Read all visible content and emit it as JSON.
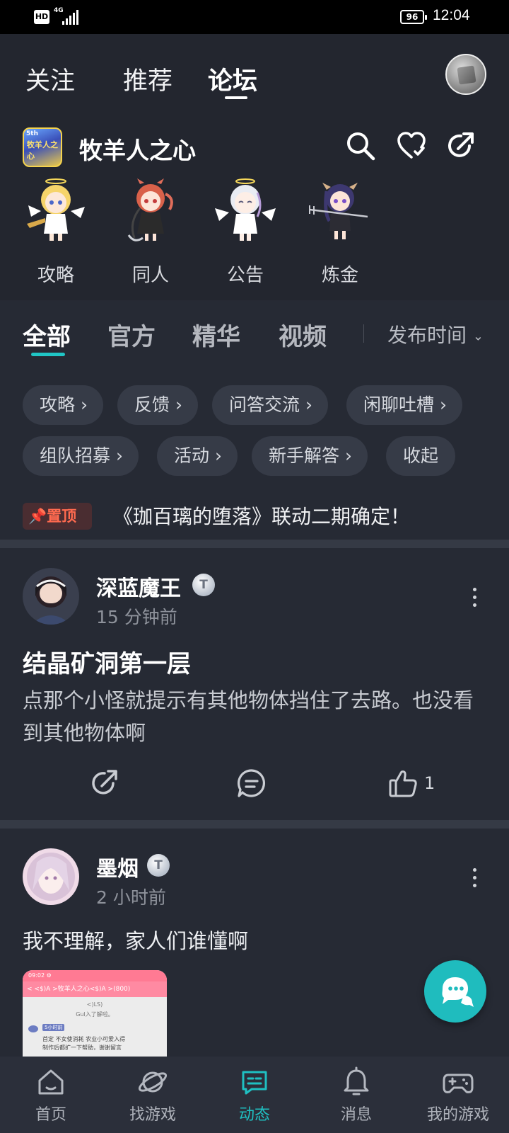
{
  "status_bar": {
    "hd": "HD",
    "network": "4G",
    "battery": "96",
    "time": "12:04"
  },
  "top_tabs": {
    "follow": "关注",
    "recommend": "推荐",
    "forum": "论坛"
  },
  "game": {
    "name": "牧羊人之心",
    "icon_text": "牧羊人之心",
    "icon_badge": "5th"
  },
  "categories": [
    {
      "label": "攻略"
    },
    {
      "label": "同人"
    },
    {
      "label": "公告"
    },
    {
      "label": "炼金"
    }
  ],
  "section_tabs": {
    "all": "全部",
    "official": "官方",
    "featured": "精华",
    "video": "视频",
    "sort": "发布时间"
  },
  "chips": [
    "攻略",
    "反馈",
    "问答交流",
    "闲聊吐槽",
    "组队招募",
    "活动",
    "新手解答",
    "收起"
  ],
  "pinned": {
    "badge": "置顶",
    "title": "《珈百璃的堕落》联动二期确定！"
  },
  "posts": [
    {
      "author": "深蓝魔王",
      "badge": "T",
      "time": "15 分钟前",
      "title": "结晶矿洞第一层",
      "body": "点那个小怪就提示有其他物体挡住了去路。也没看到其他物体啊",
      "likes": "1"
    },
    {
      "author": "墨烟",
      "badge": "T",
      "time": "2 小时前",
      "body": "我不理解，家人们谁懂啊"
    }
  ],
  "thumb": {
    "status": "09:02 ⚙",
    "header": "< <$)A  >牧羊人之心<$)A  >(800)",
    "line1": "<)LS)",
    "line2": "Gul入了解啦。",
    "badge": "5小时前",
    "line3": "首定 不女使消耗 农业小可爱入得",
    "line4": "制作后都扩一下帮助，谢谢留言"
  },
  "bottom_nav": [
    {
      "label": "首页",
      "icon": "home-icon"
    },
    {
      "label": "找游戏",
      "icon": "planet-icon"
    },
    {
      "label": "动态",
      "icon": "feed-icon"
    },
    {
      "label": "消息",
      "icon": "bell-icon"
    },
    {
      "label": "我的游戏",
      "icon": "gamepad-icon"
    }
  ],
  "colors": {
    "accent": "#1fc0c2",
    "background": "#23262f",
    "pin": "#ff6a4f"
  }
}
